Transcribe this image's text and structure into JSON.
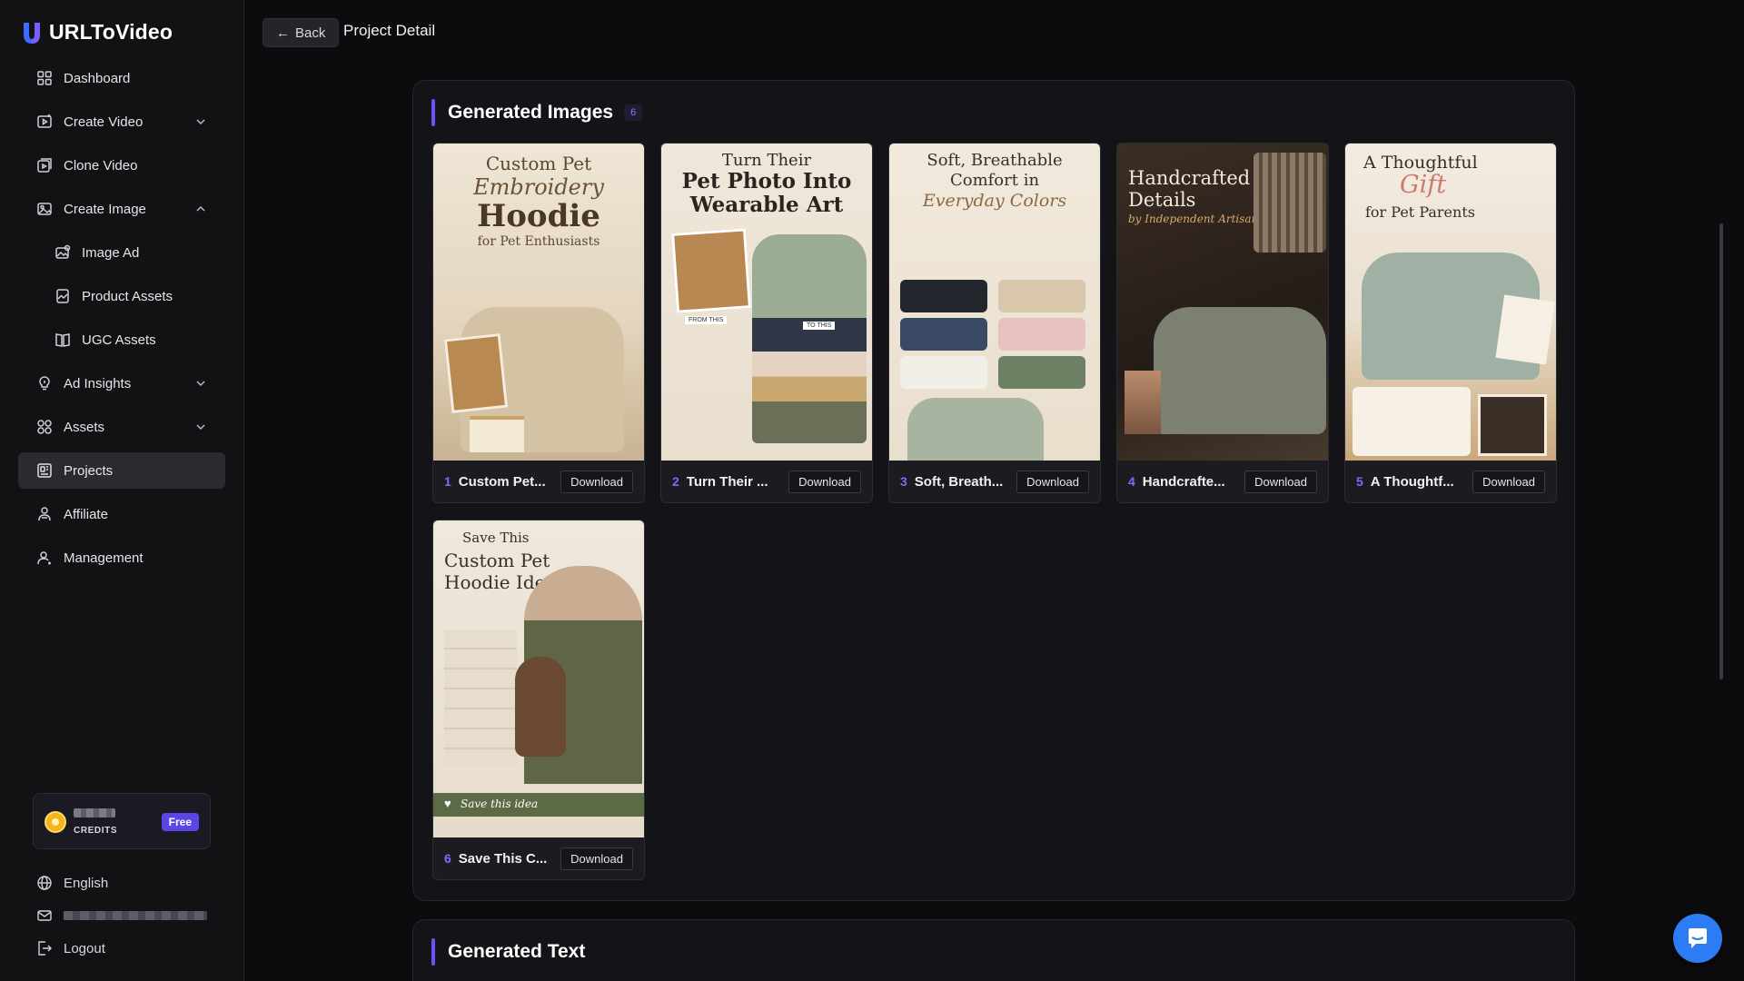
{
  "app": {
    "brand": "URLToVideo",
    "accent": "#6b52ff"
  },
  "sidebar": {
    "items": [
      {
        "label": "Dashboard",
        "icon": "dashboard-icon"
      },
      {
        "label": "Create Video",
        "icon": "video-icon",
        "chevron": "down"
      },
      {
        "label": "Clone Video",
        "icon": "clone-icon"
      },
      {
        "label": "Create Image",
        "icon": "image-icon",
        "chevron": "up"
      },
      {
        "label": "Image Ad",
        "icon": "image-ad-icon",
        "sub": true
      },
      {
        "label": "Product Assets",
        "icon": "product-icon",
        "sub": true
      },
      {
        "label": "UGC Assets",
        "icon": "book-icon",
        "sub": true
      },
      {
        "label": "Ad Insights",
        "icon": "bulb-icon",
        "chevron": "down"
      },
      {
        "label": "Assets",
        "icon": "grid-icon",
        "chevron": "down"
      },
      {
        "label": "Projects",
        "icon": "projects-icon",
        "active": true
      },
      {
        "label": "Affiliate",
        "icon": "affiliate-icon"
      },
      {
        "label": "Management",
        "icon": "user-icon"
      }
    ],
    "credits": {
      "label": "CREDITS",
      "plan": "Free"
    },
    "language": "English",
    "logout": "Logout"
  },
  "header": {
    "back_label": "Back",
    "title": "Project Detail"
  },
  "images_section": {
    "title": "Generated Images",
    "count": "6",
    "cards": [
      {
        "num": "1",
        "name": "Custom Pet...",
        "download": "Download"
      },
      {
        "num": "2",
        "name": "Turn Their ...",
        "download": "Download"
      },
      {
        "num": "3",
        "name": "Soft, Breath...",
        "download": "Download"
      },
      {
        "num": "4",
        "name": "Handcrafte...",
        "download": "Download"
      },
      {
        "num": "5",
        "name": "A Thoughtf...",
        "download": "Download"
      },
      {
        "num": "6",
        "name": "Save This C...",
        "download": "Download"
      }
    ],
    "thumbs": [
      {
        "l1": "Custom Pet",
        "l2": "Embroidery",
        "l3": "Hoodie",
        "l4": "for Pet Enthusiasts"
      },
      {
        "l1": "Turn Their",
        "l2": "Pet Photo Into",
        "l3": "Wearable Art",
        "tag_from": "FROM THIS",
        "tag_to": "TO THIS"
      },
      {
        "l1": "Soft, Breathable",
        "l2": "Comfort in",
        "l3": "Everyday Colors"
      },
      {
        "l1": "Handcrafted",
        "l2": "Details",
        "l3": "by Independent Artisans"
      },
      {
        "l1": "A Thoughtful",
        "l2": "Gift",
        "l3": "for Pet Parents"
      },
      {
        "l1": "Save This",
        "l2": "Custom Pet",
        "l3": "Hoodie Idea",
        "footer": "Save this idea"
      }
    ]
  },
  "text_section": {
    "title": "Generated Text"
  }
}
